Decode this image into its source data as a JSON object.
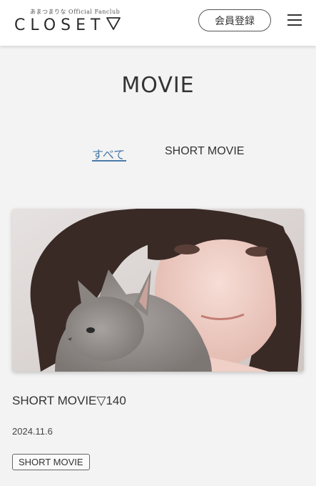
{
  "header": {
    "logo_sub": "あまつまりな Official Fanclub",
    "logo_main": "CLOSET",
    "logo_icon": "triangle-down-outline-icon",
    "member_button": "会員登録",
    "menu_icon": "hamburger-menu-icon"
  },
  "page": {
    "title": "MOVIE"
  },
  "tabs": [
    {
      "label": "すべて",
      "active": true
    },
    {
      "label": "SHORT MOVIE",
      "active": false
    }
  ],
  "post": {
    "title": "SHORT MOVIE▽140",
    "date": "2024.11.6",
    "tag": "SHORT MOVIE"
  },
  "colors": {
    "background": "#f3f3f3",
    "header_bg": "#ffffff",
    "accent_link": "#4a7aa8",
    "text": "#333333"
  }
}
